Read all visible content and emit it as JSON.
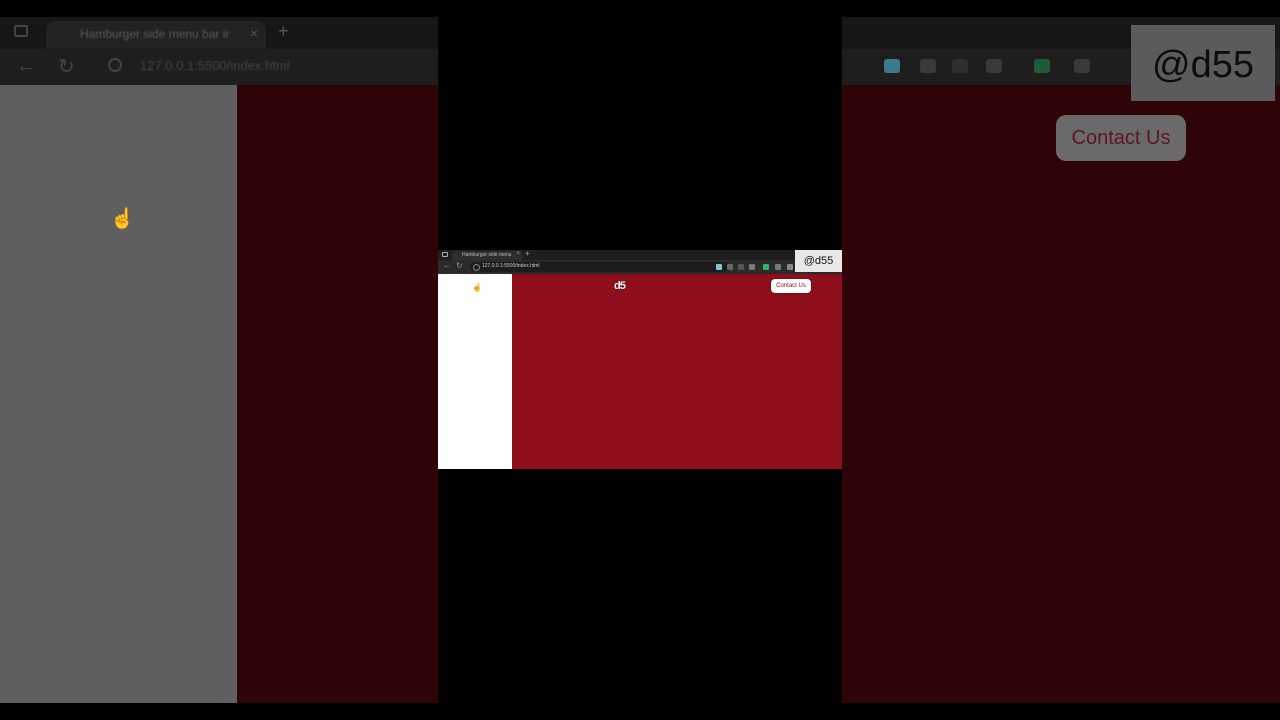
{
  "browser": {
    "tab_title": "Hamburger side menu bar in w...",
    "tab_close": "×",
    "new_tab": "+",
    "url": "127.0.0.1:5500/index.html",
    "back": "←",
    "reload": "↻"
  },
  "page": {
    "logo_text": "d5",
    "contact_label": "Contact Us",
    "colors": {
      "main_bg": "#8f0e1c",
      "sidebar_bg": "#ffffff"
    }
  },
  "watermark": {
    "text": "@d55"
  },
  "icons": {
    "cursor": "hand-pointer-icon"
  }
}
